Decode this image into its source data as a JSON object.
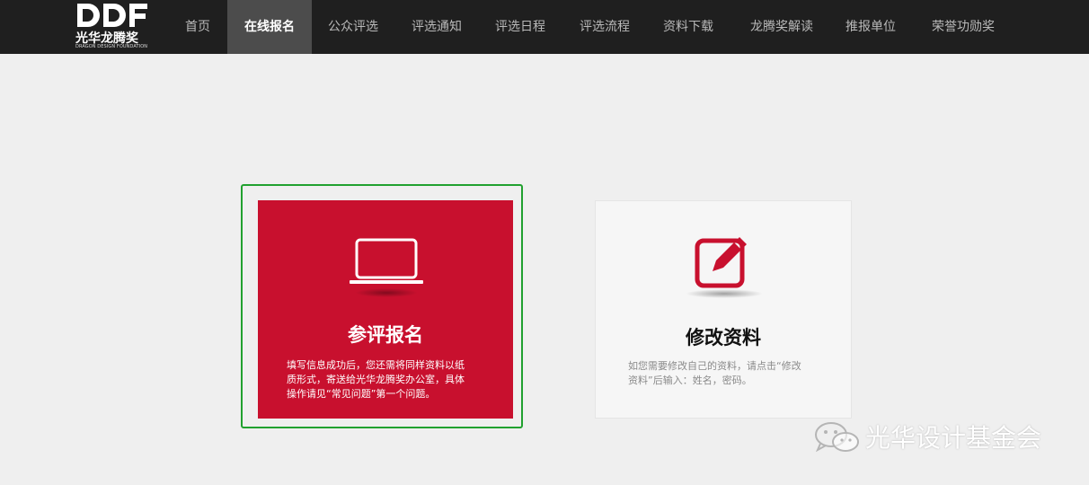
{
  "brand": {
    "logo_mark": "DDF",
    "name_cn": "光华龙腾奖",
    "name_en": "DRAGON DESIGN FOUNDATION"
  },
  "nav": {
    "items": [
      {
        "label": "首页",
        "active": false
      },
      {
        "label": "在线报名",
        "active": true
      },
      {
        "label": "公众评选",
        "active": false
      },
      {
        "label": "评选通知",
        "active": false
      },
      {
        "label": "评选日程",
        "active": false
      },
      {
        "label": "评选流程",
        "active": false
      },
      {
        "label": "资料下载",
        "active": false
      },
      {
        "label": "龙腾奖解读",
        "active": false
      },
      {
        "label": "推报单位",
        "active": false
      },
      {
        "label": "荣誉功勋奖",
        "active": false
      }
    ]
  },
  "cards": {
    "register": {
      "icon": "laptop-icon",
      "title": "参评报名",
      "desc_lines": [
        "填写信息成功后，您还需将同样资料以纸",
        "质形式，寄送给光华龙腾奖办公室，具体",
        "操作请见“常见问题”第一个问题。"
      ]
    },
    "edit": {
      "icon": "edit-pencil-icon",
      "title": "修改资料",
      "desc_lines": [
        "如您需要修改自己的资料，请点击“修改",
        "资料”后输入：姓名，密码。"
      ]
    }
  },
  "watermark": {
    "icon": "wechat-icon",
    "text": "光华设计基金会"
  },
  "colors": {
    "nav_bg": "#1f1f1f",
    "nav_active_bg": "#4c4c4c",
    "card_red": "#c8102e",
    "selection_green": "#21a12f",
    "page_bg": "#efefef"
  }
}
